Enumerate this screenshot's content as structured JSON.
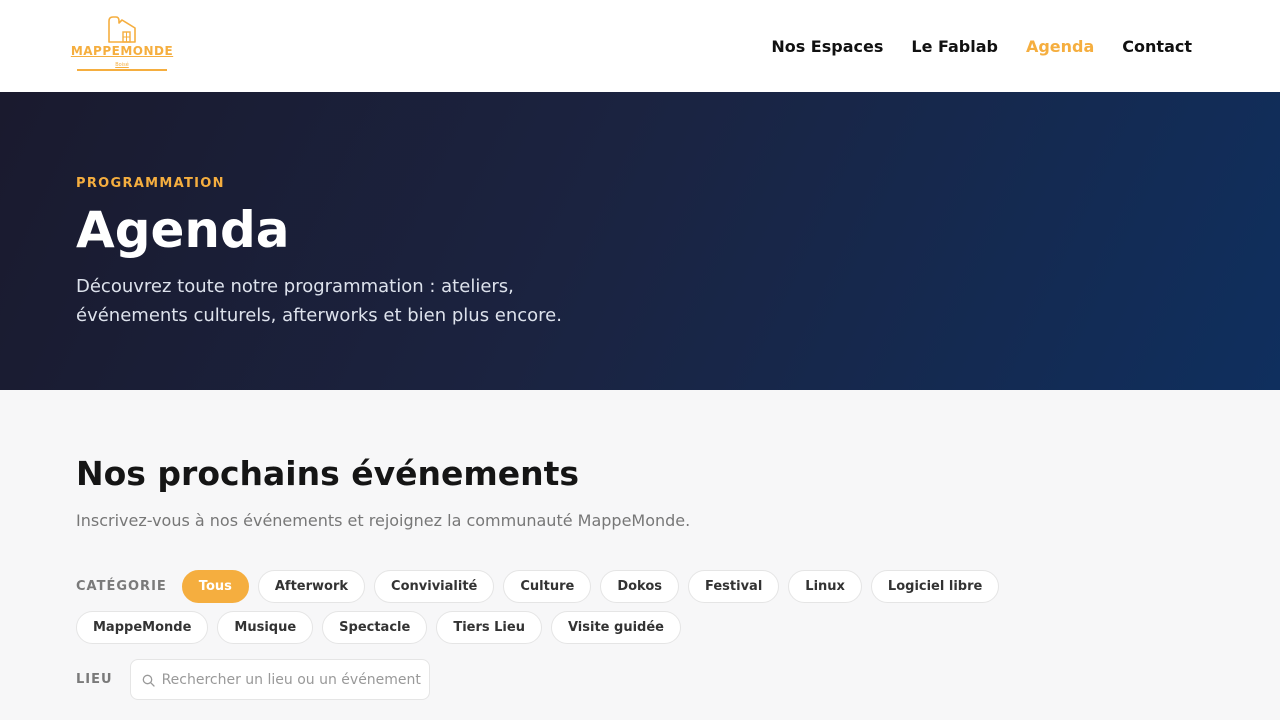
{
  "header": {
    "logo": {
      "text": "MAPPEMONDE",
      "sub": "Boisé"
    },
    "nav": [
      {
        "label": "Nos Espaces",
        "active": false
      },
      {
        "label": "Le Fablab",
        "active": false
      },
      {
        "label": "Agenda",
        "active": true
      },
      {
        "label": "Contact",
        "active": false
      }
    ]
  },
  "hero": {
    "eyebrow": "PROGRAMMATION",
    "title": "Agenda",
    "description": "Découvrez toute notre programmation : ateliers, événements culturels, afterworks et bien plus encore."
  },
  "events": {
    "title": "Nos prochains événements",
    "intro": "Inscrivez-vous à nos événements et rejoignez la communauté MappeMonde."
  },
  "filters": {
    "category_label": "CATÉGORIE",
    "categories": [
      {
        "label": "Tous",
        "active": true
      },
      {
        "label": "Afterwork",
        "active": false
      },
      {
        "label": "Convivialité",
        "active": false
      },
      {
        "label": "Culture",
        "active": false
      },
      {
        "label": "Dokos",
        "active": false
      },
      {
        "label": "Festival",
        "active": false
      },
      {
        "label": "Linux",
        "active": false
      },
      {
        "label": "Logiciel libre",
        "active": false
      },
      {
        "label": "MappeMonde",
        "active": false
      },
      {
        "label": "Musique",
        "active": false
      },
      {
        "label": "Spectacle",
        "active": false
      },
      {
        "label": "Tiers Lieu",
        "active": false
      },
      {
        "label": "Visite guidée",
        "active": false
      }
    ],
    "location_label": "LIEU",
    "search": {
      "value": "",
      "placeholder": "Rechercher un lieu ou un événement",
      "icon": "search-icon"
    }
  },
  "colors": {
    "accent": "#f5ae3f",
    "hero_start": "#1a1a2e",
    "hero_end": "#0f2f5e",
    "page_bg": "#f7f7f8"
  }
}
